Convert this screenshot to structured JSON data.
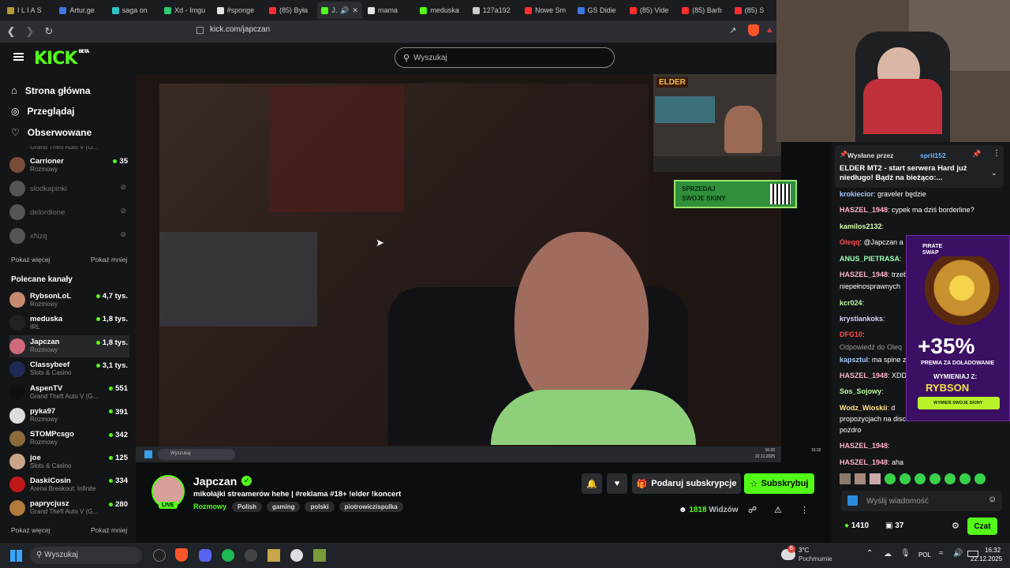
{
  "browser": {
    "tabs": [
      {
        "title": "I L I A S",
        "color": "#b59a3a"
      },
      {
        "title": "Artur.ge",
        "color": "#3d78e0"
      },
      {
        "title": "saga on",
        "color": "#29c4c4"
      },
      {
        "title": "Xd - Imgu",
        "color": "#2ecc71"
      },
      {
        "title": "#sponge",
        "color": "#e5e5e5"
      },
      {
        "title": "(85) Była",
        "color": "#ff2d2d"
      },
      {
        "title": "Ja",
        "color": "#53fc18",
        "active": true
      },
      {
        "title": "mama",
        "color": "#e5e5e5"
      },
      {
        "title": "meduska",
        "color": "#53fc18"
      },
      {
        "title": "127a192",
        "color": "#cccccc"
      },
      {
        "title": "Nowe Sm",
        "color": "#ff2d2d"
      },
      {
        "title": "GS Didie",
        "color": "#3d78e0"
      },
      {
        "title": "(85) Vide",
        "color": "#ff2d2d"
      },
      {
        "title": "(85) Barb",
        "color": "#ff2d2d"
      },
      {
        "title": "(85) S",
        "color": "#ff2d2d"
      }
    ],
    "url": "kick.com/japczan"
  },
  "header": {
    "logo": "KICK",
    "beta": "BETA",
    "search_placeholder": "Wyszukaj"
  },
  "sidebar": {
    "nav": [
      {
        "label": "Strona główna",
        "icon": "home-icon"
      },
      {
        "label": "Przeglądaj",
        "icon": "compass-icon"
      },
      {
        "label": "Obserwowane",
        "icon": "heart-icon"
      }
    ],
    "followed_cut": "Grand Theft Auto V (G...",
    "followed": [
      {
        "name": "Carrioner",
        "category": "Rozmowy",
        "viewers": "35",
        "online": true,
        "color": "#7a4b3a"
      },
      {
        "name": "slodkapinki",
        "online": false,
        "color": "#555"
      },
      {
        "name": "delordione",
        "online": false,
        "color": "#555"
      },
      {
        "name": "xNzq",
        "online": false,
        "color": "#555"
      }
    ],
    "show_more": "Pokaż więcej",
    "show_less": "Pokaż mniej",
    "recommended_title": "Polecane kanały",
    "recommended": [
      {
        "name": "RybsonLoL",
        "category": "Rozmowy",
        "viewers": "4,7 tys.",
        "color": "#c58a6e"
      },
      {
        "name": "meduska",
        "category": "IRL",
        "viewers": "1,8 tys.",
        "color": "#222"
      },
      {
        "name": "Japczan",
        "category": "Rozmowy",
        "viewers": "1,8 tys.",
        "color": "#d06a7a",
        "active": true
      },
      {
        "name": "Classybeef",
        "category": "Slots & Casino",
        "viewers": "3,1 tys.",
        "color": "#1e2a55"
      },
      {
        "name": "AspenTV",
        "category": "Grand Theft Auto V (G...",
        "viewers": "551",
        "color": "#111"
      },
      {
        "name": "pyka97",
        "category": "Rozmowy",
        "viewers": "391",
        "color": "#ddd"
      },
      {
        "name": "STOMPcsgo",
        "category": "Rozmowy",
        "viewers": "342",
        "color": "#8a6a3a"
      },
      {
        "name": "joe",
        "category": "Slots & Casino",
        "viewers": "125",
        "color": "#caa58a"
      },
      {
        "name": "DaskiCosin",
        "category": "Arena Breakout: Infinite",
        "viewers": "334",
        "color": "#c01818"
      },
      {
        "name": "paprycjusz",
        "category": "Grand Theft Auto V (G...",
        "viewers": "280",
        "color": "#b07a3a"
      }
    ]
  },
  "stream": {
    "channel": "Japczan",
    "live": "LIVE",
    "title": "mikołajki streamerów hehe | #reklama #18+ !elder !koncert",
    "category": "Rozmowy",
    "tags": [
      "Polish",
      "gaming",
      "polski",
      "piotrowiczispulka"
    ],
    "gift_label": "Podaruj subskrypcje",
    "subscribe_label": "Subskrybuj",
    "viewers": "1818",
    "viewers_label": "Widzów",
    "overlay_logo": "ELDER",
    "overlay_banner": "SPRZEDAJ SWOJE SKINY",
    "inner_taskbar_search": "Wyszukaj",
    "inner_clock": "16:32",
    "inner_date": "22.12.2025"
  },
  "chat": {
    "pinned_by_label": "Wysłane przez",
    "pinned_user": "sprit152",
    "pinned_text": "ELDER MT2 - start serwera Hard już niedługo! Bądź na bieżąco:...",
    "messages": [
      {
        "user": "krokiecior",
        "text": "graveler będzie",
        "color": "#a0c8ff"
      },
      {
        "user": "HASZEL_1948",
        "text": "cypek ma dziś borderline?",
        "color": "#ffb3c8"
      },
      {
        "user": "kamilos2132",
        "text": "",
        "color": "#d7ffb0"
      },
      {
        "user": "Oleqq",
        "text": "@Japczan a",
        "color": "#ff4b4b"
      },
      {
        "user": "ANUS_PIETRASA",
        "text": "",
        "color": "#9dffb0"
      },
      {
        "user": "HASZEL_1948",
        "text": "trzeb",
        "color": "#ffb3c8"
      },
      {
        "user": "",
        "text": "niepełnosprawnych",
        "color": "#fff"
      },
      {
        "user": "kcr024",
        "text": "",
        "color": "#b8ffa0"
      },
      {
        "user": "krystiankoks",
        "text": "",
        "color": "#d7d7ff"
      },
      {
        "user": "DFG10",
        "text": "",
        "color": "#ff4b4b"
      },
      {
        "user": "",
        "text": "Odpowiedź do Oleq",
        "color": "#999"
      },
      {
        "user": "kapsztul",
        "text": "ma spine z",
        "color": "#a0c8ff"
      },
      {
        "user": "HASZEL_1948",
        "text": "XDDI",
        "color": "#ffb3c8"
      },
      {
        "user": "Sos_Sojowy",
        "text": "",
        "color": "#b8ffa0"
      },
      {
        "user": "Wodz_Wioskii",
        "text": "d",
        "color": "#ffe38a"
      },
      {
        "user": "",
        "text": "propozycjach na disc",
        "color": "#fff"
      },
      {
        "user": "",
        "text": "pozdro",
        "color": "#fff"
      },
      {
        "user": "HASZEL_1948",
        "text": "",
        "color": "#ffb3c8"
      },
      {
        "user": "HASZEL_1948",
        "text": "aha",
        "color": "#ffb3c8"
      }
    ],
    "input_placeholder": "Wyślij wiadomość",
    "points": "1410",
    "gifts": "37",
    "send_label": "Czat",
    "ad_brand": "PIRATE SWAP",
    "ad_percent": "+35%",
    "ad_sub": "PREMIA ZA DOŁADOWANIE",
    "ad_exchange": "WYMIENIAJ Z:",
    "ad_code": "RYBSON",
    "ad_button": "WYMIEŃ SWOJE SKINY"
  },
  "taskbar": {
    "search": "Wyszukaj",
    "weather_temp": "3°C",
    "weather_desc": "Pochmurnie",
    "lang": "POL",
    "time": "16:32",
    "date": "22.12.2025",
    "badge": "6"
  },
  "colors": {
    "kick_green": "#53fc18",
    "bg": "#0b0e0f",
    "sidebar": "#141517"
  }
}
